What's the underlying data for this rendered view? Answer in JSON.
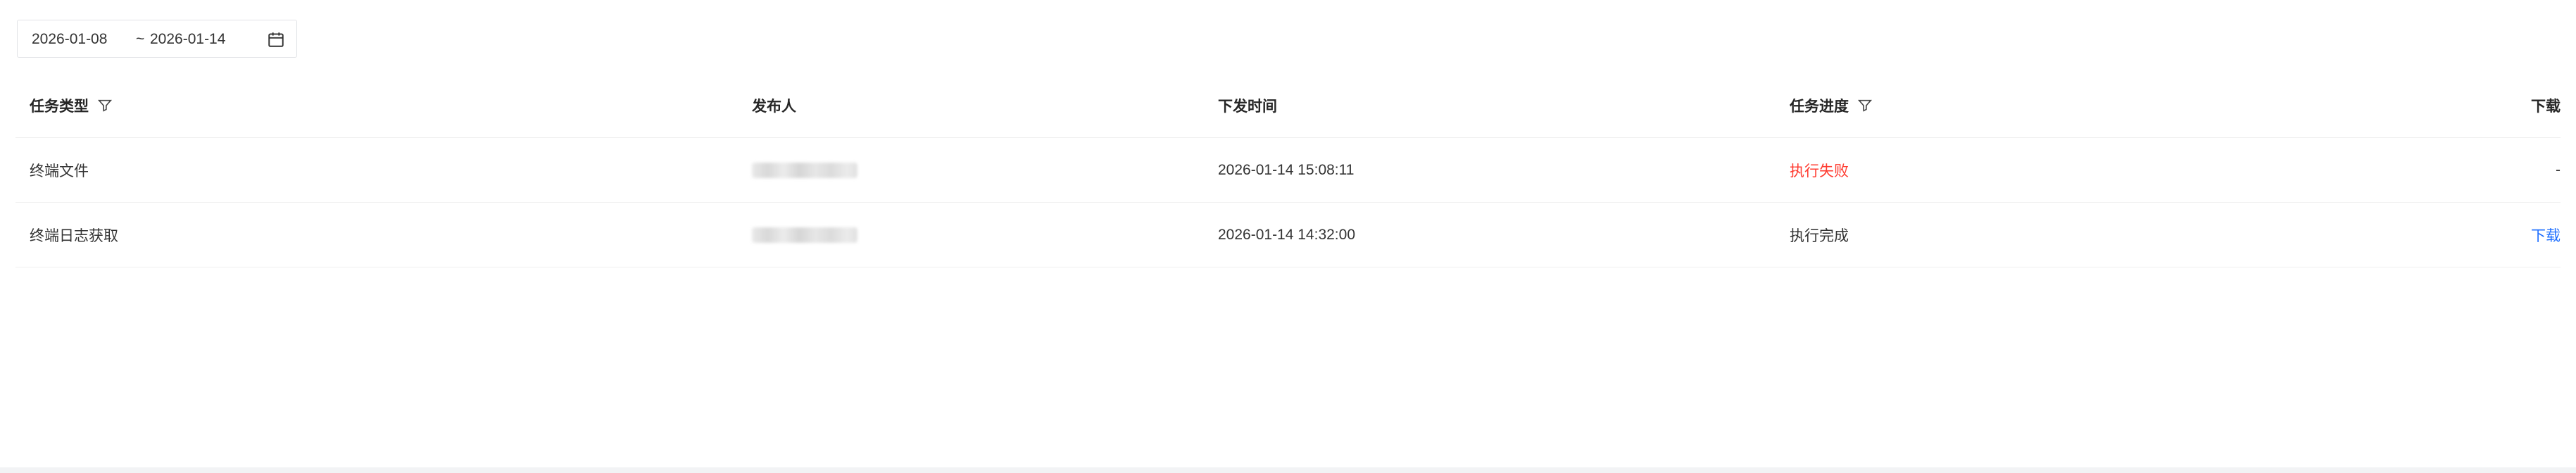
{
  "date_range": {
    "start": "2026-01-08",
    "separator": "~",
    "end": "2026-01-14",
    "icon": "calendar-icon"
  },
  "table": {
    "headers": {
      "task_type": "任务类型",
      "publisher": "发布人",
      "issue_time": "下发时间",
      "progress": "任务进度",
      "download": "下载"
    },
    "header_icons": {
      "task_type_filter": "filter-icon",
      "progress_filter": "filter-icon"
    },
    "rows": [
      {
        "task_type": "终端文件",
        "publisher": "",
        "issue_time": "2026-01-14 15:08:11",
        "progress": "执行失败",
        "progress_color": "#ff3b30",
        "download": "-"
      },
      {
        "task_type": "终端日志获取",
        "publisher": "",
        "issue_time": "2026-01-14 14:32:00",
        "progress": "执行完成",
        "progress_color": "#333333",
        "download": "下载",
        "download_color": "#1f6fff"
      }
    ]
  }
}
